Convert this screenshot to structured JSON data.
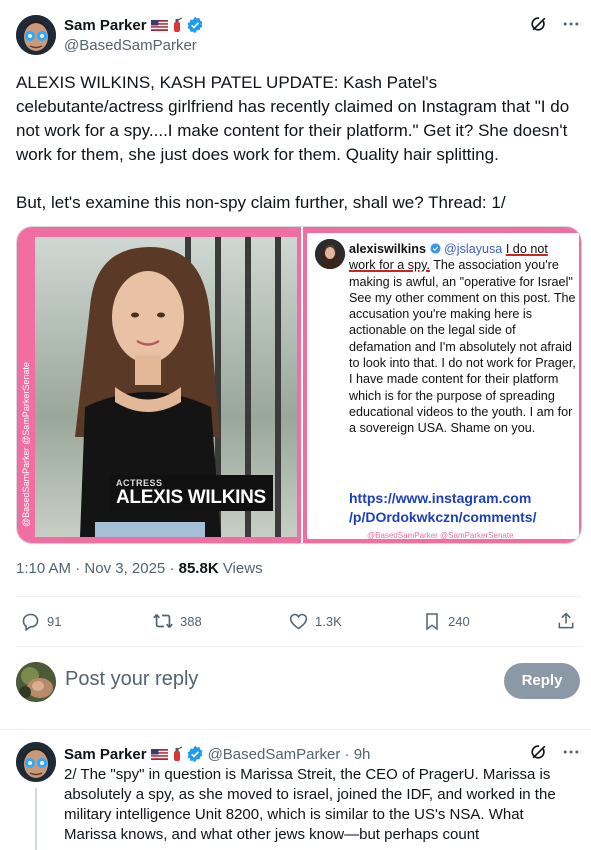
{
  "main_tweet": {
    "author_name": "Sam Parker",
    "author_handle": "@BasedSamParker",
    "text": "ALEXIS WILKINS, KASH PATEL UPDATE: Kash Patel's celebutante/actress girlfriend has recently claimed on Instagram that \"I do not work for a spy....I make content for their platform.\" Get it? She doesn't work for them, she just does work for them. Quality hair splitting.\n\nBut, let's examine this non-spy claim further, shall we? Thread: 1/",
    "media": {
      "left": {
        "label_small": "ACTRESS",
        "label_name": "ALEXIS WILKINS",
        "credit": "@BasedSamParker @SamParkerSenate"
      },
      "right": {
        "ig_user": "alexiswilkins",
        "ig_mention": "@jslayusa",
        "ig_underlined": "I do not work for a spy.",
        "ig_body": " The association you're making is awful, an \"operative for Israel\"\nSee my other comment on this post. The accusation you're making here is actionable on the legal side of defamation and I'm absolutely not afraid to look into that. I do not work for Prager, I have made content for their platform which is for the purpose of spreading educational videos to the youth. I am for a sovereign USA. Shame on you.",
        "ig_link": "https://www.instagram.com /p/DOrdokwkczn/comments/",
        "credit": "@BasedSamParker @SamParkerSenate"
      }
    },
    "time": "1:10 AM",
    "date": "Nov 3, 2025",
    "views_count": "85.8K",
    "views_label": "Views",
    "stats": {
      "replies": "91",
      "reposts": "388",
      "likes": "1.3K",
      "bookmarks": "240"
    }
  },
  "reply_bar": {
    "placeholder": "Post your reply",
    "button": "Reply"
  },
  "reply_tweet": {
    "author_name": "Sam Parker",
    "author_handle": "@BasedSamParker",
    "time_ago": "9h",
    "text": "2/ The \"spy\" in question is Marissa Streit, the CEO of PragerU. Marissa is absolutely a spy, as she moved to israel, joined the IDF, and worked in the military intelligence Unit 8200, which is similar to the US's NSA. What Marissa knows, and what other jews know—but perhaps count"
  },
  "colors": {
    "verified_blue": "#1d9bf0",
    "text_primary": "#0f1419",
    "text_secondary": "#536471",
    "reply_button_bg": "#8b98a5",
    "media_pink": "#f06fa0"
  },
  "icons": [
    "avatar",
    "us-flag-icon",
    "fire-extinguisher-icon",
    "verified-badge-icon",
    "grok-icon",
    "more-icon",
    "reply-icon",
    "repost-icon",
    "like-icon",
    "bookmark-icon",
    "share-icon"
  ]
}
